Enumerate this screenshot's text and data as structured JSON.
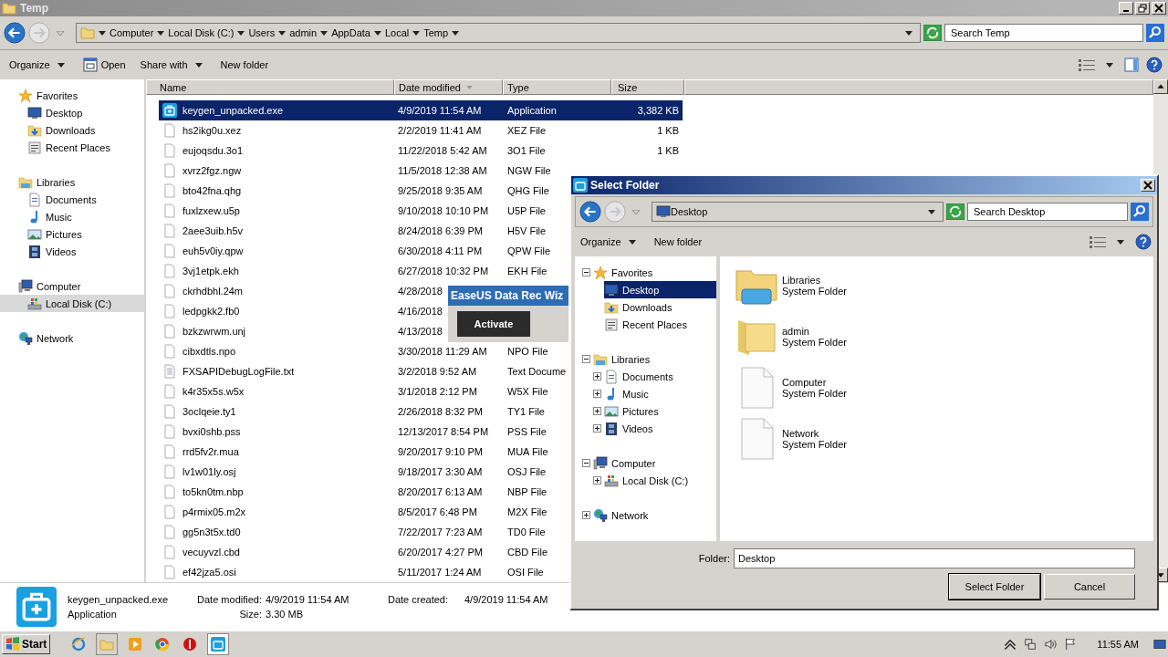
{
  "window": {
    "title": "Temp"
  },
  "address": {
    "crumbs": [
      "Computer",
      "Local Disk (C:)",
      "Users",
      "admin",
      "AppData",
      "Local",
      "Temp"
    ],
    "search_placeholder": "Search Temp"
  },
  "toolbar": [
    {
      "label": "Organize",
      "kind": "menu"
    },
    {
      "label": "Open",
      "kind": "icon"
    },
    {
      "label": "Share with",
      "kind": "menu"
    },
    {
      "label": "New folder",
      "kind": "plain"
    }
  ],
  "nav": [
    {
      "label": "Favorites",
      "selected": false,
      "children": [
        {
          "label": "Desktop",
          "selected": false
        },
        {
          "label": "Downloads",
          "selected": false
        },
        {
          "label": "Recent Places",
          "selected": false
        }
      ]
    },
    {
      "label": "Libraries",
      "selected": false,
      "children": [
        {
          "label": "Documents",
          "selected": false
        },
        {
          "label": "Music",
          "selected": false
        },
        {
          "label": "Pictures",
          "selected": false
        },
        {
          "label": "Videos",
          "selected": false
        }
      ]
    },
    {
      "label": "Computer",
      "selected": false,
      "children": [
        {
          "label": "Local Disk (C:)",
          "selected": true
        }
      ]
    },
    {
      "label": "Network",
      "selected": false
    }
  ],
  "files": {
    "columns": [
      "Name",
      "Date modified",
      "Type",
      "Size"
    ],
    "rows": [
      {
        "name": "keygen_unpacked.exe",
        "date": "4/9/2019 11:54 AM",
        "type": "Application",
        "size": "3,382 KB",
        "selected": true
      },
      {
        "name": "hs2ikg0u.xez",
        "date": "2/2/2019 11:41 AM",
        "type": "XEZ File",
        "size": "1 KB",
        "selected": false
      },
      {
        "name": "eujoqsdu.3o1",
        "date": "11/22/2018 5:42 AM",
        "type": "3O1 File",
        "size": "1 KB",
        "selected": false
      },
      {
        "name": "xvrz2fgz.ngw",
        "date": "11/5/2018 12:38 AM",
        "type": "NGW File",
        "selected": false
      },
      {
        "name": "bto42fna.qhg",
        "date": "9/25/2018 9:35 AM",
        "type": "QHG File",
        "selected": false
      },
      {
        "name": "fuxlzxew.u5p",
        "date": "9/10/2018 10:10 PM",
        "type": "U5P File",
        "selected": false
      },
      {
        "name": "2aee3uib.h5v",
        "date": "8/24/2018 6:39 PM",
        "type": "H5V File",
        "selected": false
      },
      {
        "name": "euh5v0iy.qpw",
        "date": "6/30/2018 4:11 PM",
        "type": "QPW File",
        "selected": false
      },
      {
        "name": "3vj1etpk.ekh",
        "date": "6/27/2018 10:32 PM",
        "type": "EKH File",
        "selected": false
      },
      {
        "name": "ckrhdbhl.24m",
        "date": "4/28/2018",
        "selected": false
      },
      {
        "name": "ledpgkk2.fb0",
        "date": "4/16/2018",
        "selected": false
      },
      {
        "name": "bzkzwrwm.unj",
        "date": "4/13/2018",
        "selected": false
      },
      {
        "name": "cibxdtls.npo",
        "date": "3/30/2018 11:29 AM",
        "type": "NPO File",
        "selected": false
      },
      {
        "name": "FXSAPIDebugLogFile.txt",
        "date": "3/2/2018 9:52 AM",
        "type": "Text Docume",
        "selected": false
      },
      {
        "name": "k4r35x5s.w5x",
        "date": "3/1/2018 2:12 PM",
        "type": "W5X File",
        "selected": false
      },
      {
        "name": "3oclqeie.ty1",
        "date": "2/26/2018 8:32 PM",
        "type": "TY1 File",
        "selected": false
      },
      {
        "name": "bvxi0shb.pss",
        "date": "12/13/2017 8:54 PM",
        "type": "PSS File",
        "selected": false
      },
      {
        "name": "rrd5fv2r.mua",
        "date": "9/20/2017 9:10 PM",
        "type": "MUA File",
        "selected": false
      },
      {
        "name": "lv1w01ly.osj",
        "date": "9/18/2017 3:30 AM",
        "type": "OSJ File",
        "selected": false
      },
      {
        "name": "to5kn0tm.nbp",
        "date": "8/20/2017 6:13 AM",
        "type": "NBP File",
        "selected": false
      },
      {
        "name": "p4rmix05.m2x",
        "date": "8/5/2017 6:48 PM",
        "type": "M2X File",
        "selected": false
      },
      {
        "name": "gg5n3t5x.td0",
        "date": "7/22/2017 7:23 AM",
        "type": "TD0 File",
        "selected": false
      },
      {
        "name": "vecuyvzl.cbd",
        "date": "6/20/2017 4:27 PM",
        "type": "CBD File",
        "selected": false
      },
      {
        "name": "ef42jza5.osi",
        "date": "5/11/2017 1:24 AM",
        "type": "OSI File",
        "selected": false
      }
    ]
  },
  "details": {
    "name": "keygen_unpacked.exe",
    "type": "Application",
    "modified_label": "Date modified:",
    "modified": "4/9/2019 11:54 AM",
    "size_label": "Size:",
    "size": "3.30 MB",
    "created_label": "Date created:",
    "created": "4/9/2019 11:54 AM"
  },
  "taskbar": {
    "start": "Start",
    "clock": "11:55 AM"
  },
  "popup": {
    "title": "EaseUS Data Rec Wiz",
    "button": "Activate"
  },
  "dialog": {
    "title": "Select Folder",
    "location": "Desktop",
    "search_placeholder": "Search Desktop",
    "toolbar": [
      {
        "label": "Organize",
        "kind": "menu"
      },
      {
        "label": "New folder",
        "kind": "plain"
      }
    ],
    "tree": [
      {
        "label": "Favorites",
        "expanded": true,
        "selected": false,
        "children": [
          {
            "label": "Desktop",
            "selected": true
          },
          {
            "label": "Downloads",
            "selected": false
          },
          {
            "label": "Recent Places",
            "selected": false
          }
        ]
      },
      {
        "label": "Libraries",
        "expanded": true,
        "selected": false,
        "children": [
          {
            "label": "Documents",
            "expanded": false,
            "selected": false
          },
          {
            "label": "Music",
            "expanded": false,
            "selected": false
          },
          {
            "label": "Pictures",
            "expanded": false,
            "selected": false
          },
          {
            "label": "Videos",
            "expanded": false,
            "selected": false
          }
        ]
      },
      {
        "label": "Computer",
        "expanded": true,
        "selected": false,
        "children": [
          {
            "label": "Local Disk (C:)",
            "expanded": false,
            "selected": false
          }
        ]
      },
      {
        "label": "Network",
        "expanded": false,
        "selected": false
      }
    ],
    "items": [
      {
        "name": "Libraries",
        "type": "System Folder"
      },
      {
        "name": "admin",
        "type": "System Folder"
      },
      {
        "name": "Computer",
        "type": "System Folder"
      },
      {
        "name": "Network",
        "type": "System Folder"
      }
    ],
    "folder_label": "Folder:",
    "folder_value": "Desktop",
    "buttons": [
      "Select Folder",
      "Cancel"
    ]
  }
}
